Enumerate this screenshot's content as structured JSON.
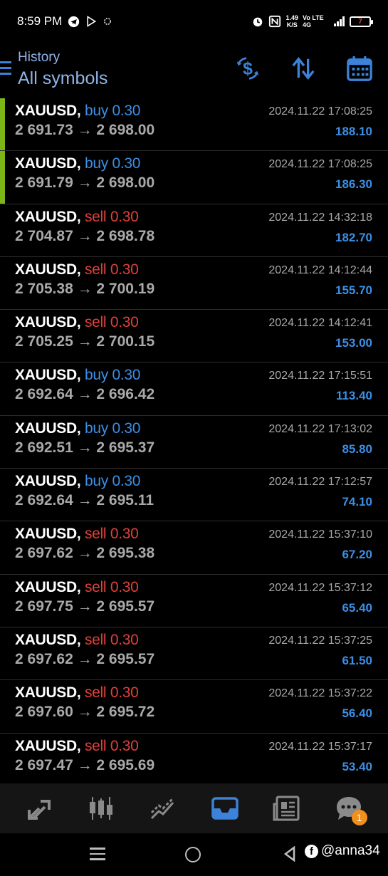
{
  "status_bar": {
    "time": "8:59 PM",
    "net_speed_value": "1.49",
    "net_speed_unit": "K/S",
    "network": "Vo LTE 4G",
    "battery": "7"
  },
  "header": {
    "subtitle": "History",
    "title": "All symbols",
    "icons": [
      "currency-exchange-icon",
      "sort-icon",
      "calendar-icon"
    ],
    "accent_color": "#3b82d8"
  },
  "trades": [
    {
      "symbol": "XAUUSD,",
      "side": "buy",
      "volume": "0.30",
      "prices": "2 691.73 → 2 698.00",
      "time": "2024.11.22 17:08:25",
      "profit": "188.10",
      "highlight": true
    },
    {
      "symbol": "XAUUSD,",
      "side": "buy",
      "volume": "0.30",
      "prices": "2 691.79 → 2 698.00",
      "time": "2024.11.22 17:08:25",
      "profit": "186.30",
      "highlight": true
    },
    {
      "symbol": "XAUUSD,",
      "side": "sell",
      "volume": "0.30",
      "prices": "2 704.87 → 2 698.78",
      "time": "2024.11.22 14:32:18",
      "profit": "182.70",
      "highlight": false
    },
    {
      "symbol": "XAUUSD,",
      "side": "sell",
      "volume": "0.30",
      "prices": "2 705.38 → 2 700.19",
      "time": "2024.11.22 14:12:44",
      "profit": "155.70",
      "highlight": false
    },
    {
      "symbol": "XAUUSD,",
      "side": "sell",
      "volume": "0.30",
      "prices": "2 705.25 → 2 700.15",
      "time": "2024.11.22 14:12:41",
      "profit": "153.00",
      "highlight": false
    },
    {
      "symbol": "XAUUSD,",
      "side": "buy",
      "volume": "0.30",
      "prices": "2 692.64 → 2 696.42",
      "time": "2024.11.22 17:15:51",
      "profit": "113.40",
      "highlight": false
    },
    {
      "symbol": "XAUUSD,",
      "side": "buy",
      "volume": "0.30",
      "prices": "2 692.51 → 2 695.37",
      "time": "2024.11.22 17:13:02",
      "profit": "85.80",
      "highlight": false
    },
    {
      "symbol": "XAUUSD,",
      "side": "buy",
      "volume": "0.30",
      "prices": "2 692.64 → 2 695.11",
      "time": "2024.11.22 17:12:57",
      "profit": "74.10",
      "highlight": false
    },
    {
      "symbol": "XAUUSD,",
      "side": "sell",
      "volume": "0.30",
      "prices": "2 697.62 → 2 695.38",
      "time": "2024.11.22 15:37:10",
      "profit": "67.20",
      "highlight": false
    },
    {
      "symbol": "XAUUSD,",
      "side": "sell",
      "volume": "0.30",
      "prices": "2 697.75 → 2 695.57",
      "time": "2024.11.22 15:37:12",
      "profit": "65.40",
      "highlight": false
    },
    {
      "symbol": "XAUUSD,",
      "side": "sell",
      "volume": "0.30",
      "prices": "2 697.62 → 2 695.57",
      "time": "2024.11.22 15:37:25",
      "profit": "61.50",
      "highlight": false
    },
    {
      "symbol": "XAUUSD,",
      "side": "sell",
      "volume": "0.30",
      "prices": "2 697.60 → 2 695.72",
      "time": "2024.11.22 15:37:22",
      "profit": "56.40",
      "highlight": false
    },
    {
      "symbol": "XAUUSD,",
      "side": "sell",
      "volume": "0.30",
      "prices": "2 697.47 → 2 695.69",
      "time": "2024.11.22 15:37:17",
      "profit": "53.40",
      "highlight": false
    }
  ],
  "bottom_nav": {
    "items": [
      "quotes-icon",
      "chart-icon",
      "trade-icon",
      "history-icon",
      "news-icon",
      "chat-icon"
    ],
    "active": "history-icon",
    "chat_badge": "1"
  },
  "watermark": {
    "handle": "@anna34"
  },
  "colors": {
    "buy": "#3c8fe6",
    "sell": "#e0403a",
    "highlight": "#7cb518",
    "profit": "#3c8fe6"
  }
}
